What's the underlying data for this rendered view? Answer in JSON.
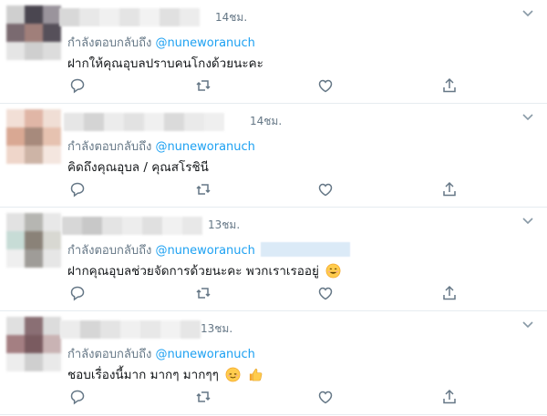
{
  "tweets": [
    {
      "time": "14ชม.",
      "reply_prefix": "กำลังตอบกลับถึง",
      "reply_handle": "@nuneworanuch",
      "text": "ฝากให้คุณอุบลปราบคนโกงด้วยนะคะ",
      "emojis": []
    },
    {
      "time": "14ชม.",
      "reply_prefix": "กำลังตอบกลับถึง",
      "reply_handle": "@nuneworanuch",
      "text": "คิดถึงคุณอุบล / คุณสโรชินี",
      "emojis": []
    },
    {
      "time": "13ชม.",
      "reply_prefix": "กำลังตอบกลับถึง",
      "reply_handle": "@nuneworanuch",
      "text": "ฝากคุณอุบลช่วยจัดการด้วยนะคะ พวกเราเรออยู่",
      "emojis": [
        "smiling-face-emoji"
      ]
    },
    {
      "time": "13ชม.",
      "reply_prefix": "กำลังตอบกลับถึง",
      "reply_handle": "@nuneworanuch",
      "text": "ชอบเรื่องนี้มาก มากๆ มากๆๆ",
      "emojis": [
        "relieved-face-emoji",
        "thumbs-up-emoji"
      ]
    }
  ],
  "colors": {
    "meta_gray": "#657786",
    "handle_blue": "#1da1f2",
    "divider": "#e6ecf0",
    "text": "#14171a"
  },
  "icons": [
    "chevron-down-icon",
    "reply-icon",
    "retweet-icon",
    "like-icon",
    "share-icon"
  ]
}
